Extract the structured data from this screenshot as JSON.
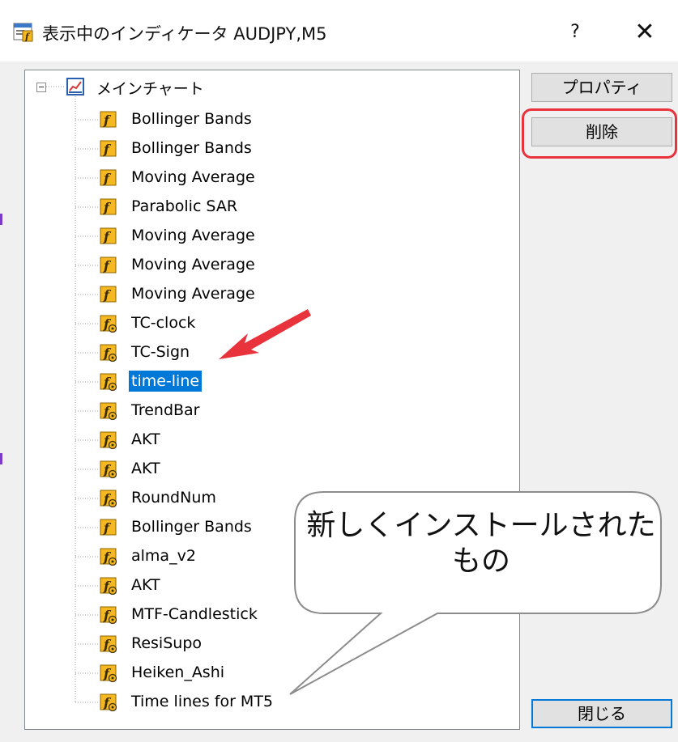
{
  "window": {
    "title": "表示中のインディケータ AUDJPY,M5",
    "help_label": "?",
    "close_glyph": "✕"
  },
  "tree": {
    "root_label": "メインチャート",
    "items": [
      {
        "label": "Bollinger Bands",
        "icon": "builtin-indicator-icon"
      },
      {
        "label": "Bollinger Bands",
        "icon": "builtin-indicator-icon"
      },
      {
        "label": "Moving Average",
        "icon": "builtin-indicator-icon"
      },
      {
        "label": "Parabolic SAR",
        "icon": "builtin-indicator-icon"
      },
      {
        "label": "Moving Average",
        "icon": "builtin-indicator-icon"
      },
      {
        "label": "Moving Average",
        "icon": "builtin-indicator-icon"
      },
      {
        "label": "Moving Average",
        "icon": "builtin-indicator-icon"
      },
      {
        "label": "TC-clock",
        "icon": "custom-indicator-icon"
      },
      {
        "label": "TC-Sign",
        "icon": "custom-indicator-icon"
      },
      {
        "label": "time-line",
        "icon": "custom-indicator-icon",
        "selected": true
      },
      {
        "label": "TrendBar",
        "icon": "custom-indicator-icon"
      },
      {
        "label": "AKT",
        "icon": "custom-indicator-icon"
      },
      {
        "label": "AKT",
        "icon": "custom-indicator-icon"
      },
      {
        "label": "RoundNum",
        "icon": "custom-indicator-icon"
      },
      {
        "label": "Bollinger Bands",
        "icon": "builtin-indicator-icon"
      },
      {
        "label": "alma_v2",
        "icon": "custom-indicator-icon"
      },
      {
        "label": "AKT",
        "icon": "custom-indicator-icon"
      },
      {
        "label": "MTF-Candlestick",
        "icon": "custom-indicator-icon"
      },
      {
        "label": "ResiSupo",
        "icon": "custom-indicator-icon"
      },
      {
        "label": "Heiken_Ashi",
        "icon": "custom-indicator-icon"
      },
      {
        "label": "Time lines for MT5",
        "icon": "custom-indicator-icon"
      }
    ]
  },
  "buttons": {
    "properties": "プロパティ",
    "delete": "削除",
    "close": "閉じる"
  },
  "annotation": {
    "callout_text": "新しくインストールされたもの",
    "highlight_color": "#e8323c",
    "arrow_color": "#e8323c"
  },
  "colors": {
    "selection": "#0078d7",
    "icon_fill": "#f5b820"
  }
}
